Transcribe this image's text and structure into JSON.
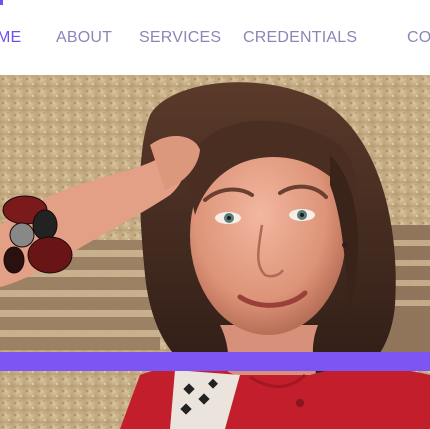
{
  "nav": {
    "items": [
      {
        "label": "ME",
        "active": true
      },
      {
        "label": "ABOUT",
        "active": false
      },
      {
        "label": "SERVICES",
        "active": false
      },
      {
        "label": "CREDENTIALS",
        "active": false
      },
      {
        "label": "CO",
        "active": false
      }
    ]
  },
  "hero": {
    "accent_color": "#7c55f2"
  },
  "colors": {
    "nav_text": "#8a86b8",
    "nav_active": "#7050f0",
    "background": "#ffffff"
  }
}
